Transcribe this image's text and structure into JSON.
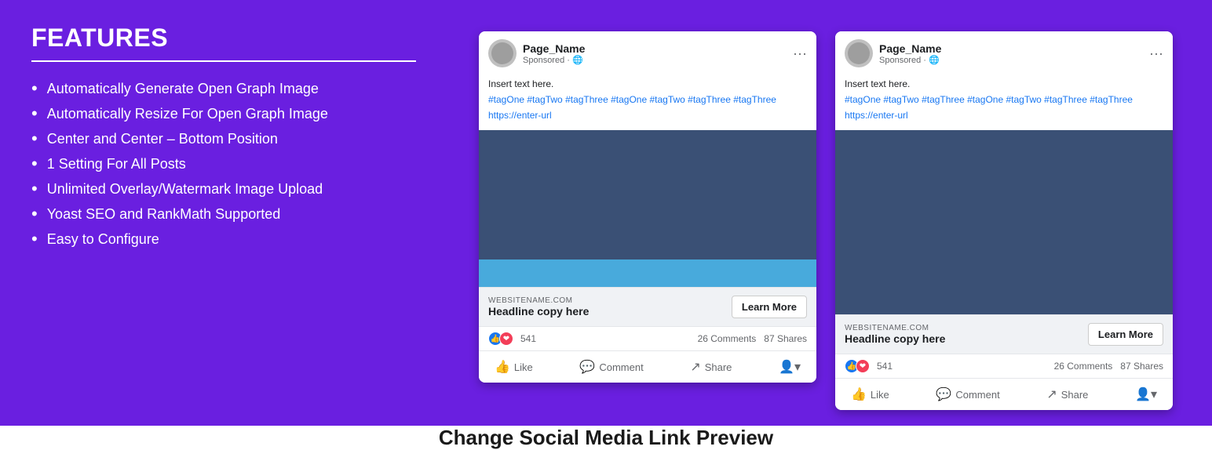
{
  "left": {
    "title": "FEATURES",
    "items": [
      "Automatically Generate Open Graph Image",
      "Automatically Resize For Open Graph Image",
      "Center and Center – Bottom Position",
      "1 Setting For All Posts",
      "Unlimited Overlay/Watermark Image Upload",
      "Yoast SEO and RankMath Supported",
      "Easy to Configure"
    ]
  },
  "cards": [
    {
      "page_name": "Page_Name",
      "sponsored": "Sponsored · 🌐",
      "insert_text": "Insert text here.",
      "tags": "#tagOne #tagTwo #tagThree #tagOne #tagTwo #tagThree #tagThree",
      "url": "https://enter-url",
      "site_name": "WEBSITENAME.COM",
      "headline": "Headline copy here",
      "learn_more": "Learn More",
      "reaction_count": "541",
      "comments": "26 Comments",
      "shares": "87 Shares",
      "like": "Like",
      "comment": "Comment",
      "share": "Share"
    },
    {
      "page_name": "Page_Name",
      "sponsored": "Sponsored · 🌐",
      "insert_text": "Insert text here.",
      "tags": "#tagOne #tagTwo #tagThree #tagOne #tagTwo #tagThree #tagThree",
      "url": "https://enter-url",
      "site_name": "WEBSITENAME.COM",
      "headline": "Headline copy here",
      "learn_more": "Learn More",
      "reaction_count": "541",
      "comments": "26 Comments",
      "shares": "87 Shares",
      "like": "Like",
      "comment": "Comment",
      "share": "Share"
    }
  ],
  "bottom_banner": "Change Social Media Link Preview"
}
